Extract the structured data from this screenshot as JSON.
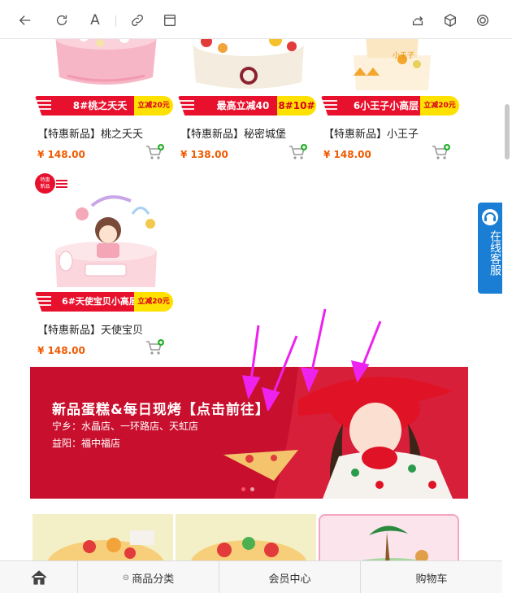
{
  "toolbar": {
    "icons": [
      "back-icon",
      "refresh-icon",
      "text-size-icon",
      "link-icon",
      "reader-icon",
      "share-icon",
      "package-icon",
      "settings-icon"
    ],
    "text_size_glyph": "A"
  },
  "products": [
    {
      "name": "【特惠新品】桃之夭夭",
      "price": "¥ 148.00",
      "promo": "8#桃之夭夭",
      "tag": "立减20元"
    },
    {
      "name": "【特惠新品】秘密城堡",
      "price": "¥ 138.00",
      "promo": "最高立减40",
      "tag": "8#10#"
    },
    {
      "name": "【特惠新品】小王子",
      "price": "¥ 148.00",
      "promo": "6小王子小高层",
      "tag": "立减20元"
    },
    {
      "name": "【特惠新品】天使宝贝",
      "price": "¥ 148.00",
      "promo": "6#天使宝贝小高层",
      "tag": "立减20元"
    }
  ],
  "special_badge": {
    "line1": "特惠",
    "line2": "新品"
  },
  "service_tab": {
    "label": "在线客服"
  },
  "banner": {
    "title": "新品蛋糕&每日现烤【点击前往】",
    "line2": "宁乡：水晶店、一环路店、天虹店",
    "line3": "益阳：福中福店",
    "slides_total": 2,
    "slide_active": 1
  },
  "bottom_nav": {
    "home_icon": "home-icon",
    "category": "商品分类",
    "member": "会员中心",
    "cart": "购物车"
  },
  "colors": {
    "accent_red": "#e8112d",
    "price_orange": "#f05a00",
    "service_blue": "#1a7fd4",
    "arrow_magenta": "#ee22ee"
  }
}
